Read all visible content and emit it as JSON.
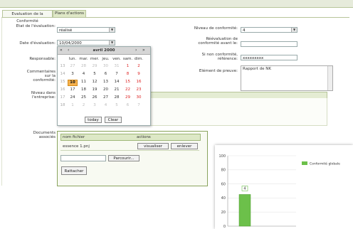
{
  "tabs": [
    {
      "label": "Evaluation de la Conformité"
    },
    {
      "label": "Plans d'actions"
    }
  ],
  "form": {
    "etat_label": "Etat de l'évaluation:",
    "etat_value": "réalisé",
    "date_label": "Date d'évaluation:",
    "date_value": "10/04/2000",
    "responsable_label": "Responsable:",
    "commentaires_label": "Commentaires sur la conformité:",
    "niveau_label": "Niveau dans l'entreprise:",
    "niveau_conf_label": "Niveau de conformité:",
    "niveau_conf_value": "4",
    "reevaluation_label": "Réévaluation de conformité avant le:",
    "si_non_conf_label": "Si non conformité, référence:",
    "si_non_conf_value": "xxxxxxxxx",
    "preuve_label": "Elément de preuve:",
    "preuve_value": "Rapport de NK"
  },
  "calendar": {
    "prev_year": "«",
    "prev_month": "‹",
    "title": "avril 2000",
    "next_month": "›",
    "next_year": "»",
    "weekdays": [
      "lun.",
      "mar.",
      "mer.",
      "jeu.",
      "ven.",
      "sam.",
      "dim."
    ],
    "week_numbers": [
      "13",
      "14",
      "15",
      "16",
      "17",
      "18"
    ],
    "rows": [
      [
        "27",
        "28",
        "29",
        "30",
        "31",
        "1",
        "2"
      ],
      [
        "3",
        "4",
        "5",
        "6",
        "7",
        "8",
        "9"
      ],
      [
        "10",
        "11",
        "12",
        "13",
        "14",
        "15",
        "16"
      ],
      [
        "17",
        "18",
        "19",
        "20",
        "21",
        "22",
        "23"
      ],
      [
        "24",
        "25",
        "26",
        "27",
        "28",
        "29",
        "30"
      ],
      [
        "1",
        "2",
        "3",
        "4",
        "5",
        "6",
        "7"
      ]
    ],
    "today_label": "today",
    "clear_label": "Clear"
  },
  "documents": {
    "label": "Documents associés",
    "col_nom": "nom fichier",
    "col_actions": "actions",
    "file_name": "essence 1.pnj",
    "visualiser_label": "visualiser",
    "enlever_label": "enlever",
    "parcourir_label": "Parcourir...",
    "rattacher_label": "Rattacher"
  },
  "chart_data": {
    "type": "bar",
    "categories": [
      ""
    ],
    "series": [
      {
        "name": "Conformité globale",
        "values": [
          45
        ]
      }
    ],
    "ylim": [
      0,
      100
    ],
    "yticks": [
      "0",
      "20",
      "40",
      "60",
      "80",
      "100"
    ],
    "data_labels": [
      "4"
    ],
    "grid": true,
    "legend": "right",
    "colors": {
      "bar": "#6cc04a"
    }
  }
}
